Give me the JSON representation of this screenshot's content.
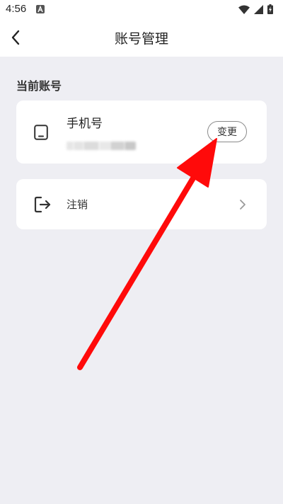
{
  "status_bar": {
    "time": "4:56",
    "icons": [
      "a-notification-icon",
      "wifi-icon",
      "signal-icon",
      "battery-charging-icon"
    ]
  },
  "header": {
    "title": "账号管理",
    "back_icon": "chevron-left-icon"
  },
  "section": {
    "title": "当前账号"
  },
  "phone_card": {
    "icon": "phone-icon",
    "label": "手机号",
    "masked_number": "",
    "change_label": "变更"
  },
  "logout_card": {
    "icon": "logout-icon",
    "label": "注销",
    "chevron_icon": "chevron-right-icon"
  },
  "annotation": {
    "arrow_color": "#ff0a0a"
  },
  "colors": {
    "background": "#eeeef3",
    "card": "#ffffff"
  }
}
